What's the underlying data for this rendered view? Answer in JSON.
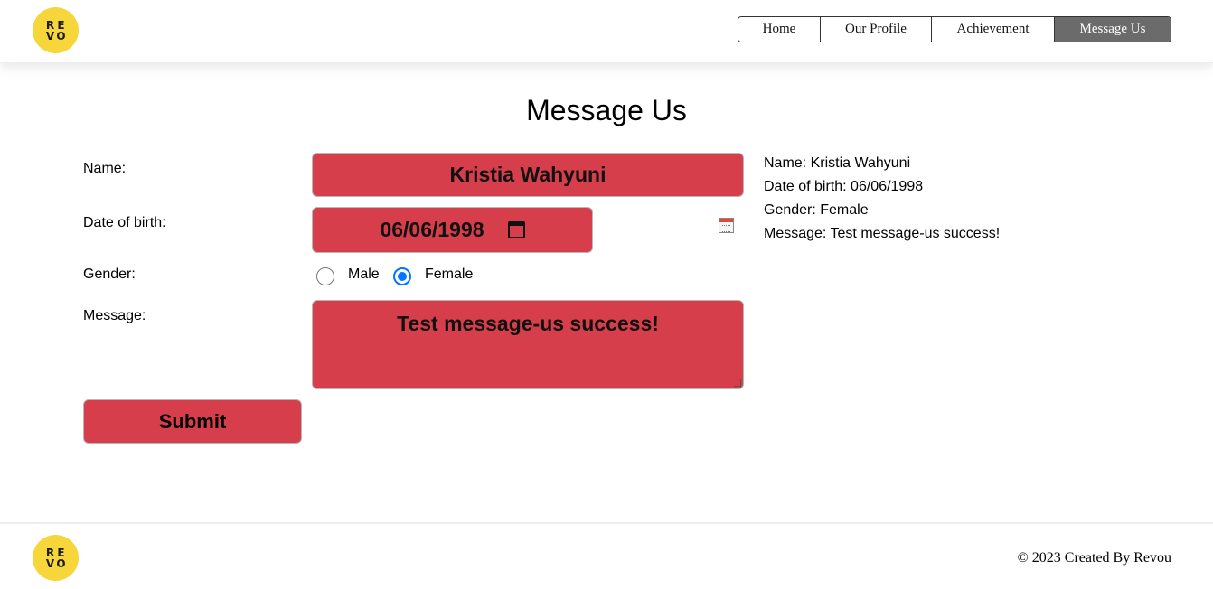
{
  "brand": {
    "logo_letters": [
      "R",
      "E",
      "V",
      "O"
    ]
  },
  "nav": {
    "items": [
      {
        "label": "Home"
      },
      {
        "label": "Our Profile"
      },
      {
        "label": "Achievement"
      },
      {
        "label": "Message Us",
        "active": true
      }
    ]
  },
  "main": {
    "title": "Message Us",
    "form": {
      "name_label": "Name:",
      "name_value": "Kristia Wahyuni",
      "dob_label": "Date of birth:",
      "dob_value": "06/06/1998",
      "gender_label": "Gender:",
      "gender_options": [
        "Male",
        "Female"
      ],
      "gender_selected": "Female",
      "message_label": "Message:",
      "message_value": "Test message-us success!",
      "submit_label": "Submit"
    },
    "result": {
      "name": "Name: Kristia Wahyuni",
      "dob": "Date of birth: 06/06/1998",
      "gender": "Gender: Female",
      "message": "Message: Test message-us success!"
    }
  },
  "footer": {
    "copyright": "© 2023 Created By Revou"
  },
  "colors": {
    "field_bg": "#d63e4b",
    "logo_bg": "#f7d63b",
    "nav_active_bg": "#6b6b6b",
    "radio_accent": "#0075ff"
  }
}
